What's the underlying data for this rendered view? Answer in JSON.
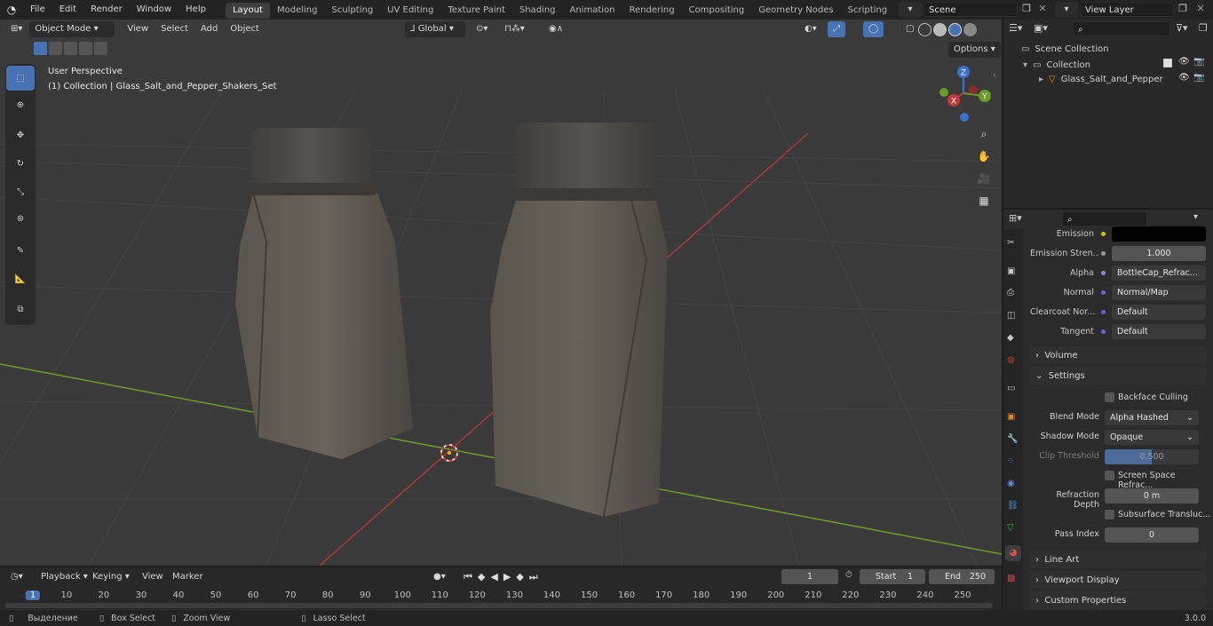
{
  "topbar": {
    "menus": [
      "File",
      "Edit",
      "Render",
      "Window",
      "Help"
    ],
    "workspaces": [
      "Layout",
      "Modeling",
      "Sculpting",
      "UV Editing",
      "Texture Paint",
      "Shading",
      "Animation",
      "Rendering",
      "Compositing",
      "Geometry Nodes",
      "Scripting"
    ],
    "active_workspace": "Layout",
    "scene": "Scene",
    "view_layer": "View Layer"
  },
  "viewport": {
    "mode": "Object Mode",
    "menus": [
      "View",
      "Select",
      "Add",
      "Object"
    ],
    "transform_orientation": "Global",
    "options_label": "Options",
    "perspective_label": "User Perspective",
    "collection_label": "(1) Collection | Glass_Salt_and_Pepper_Shakers_Set",
    "gizmo": {
      "z": "Z",
      "y": "Y",
      "x": "X"
    }
  },
  "outliner": {
    "root": "Scene Collection",
    "collection": "Collection",
    "object": "Glass_Salt_and_Pepper_S"
  },
  "properties": {
    "rows": [
      {
        "label": "Emission",
        "value": "",
        "socket": "#c8c800"
      },
      {
        "label": "Emission Stren...",
        "value": "1.000",
        "socket": ""
      },
      {
        "label": "Alpha",
        "value": "BottleCap_Refrac...",
        "socket": "#8c8cd8"
      },
      {
        "label": "Normal",
        "value": "Normal/Map",
        "socket": "#6464d8"
      },
      {
        "label": "Clearcoat Nor...",
        "value": "Default",
        "socket": "#6464d8"
      },
      {
        "label": "Tangent",
        "value": "Default",
        "socket": "#6464d8"
      }
    ],
    "volume": "Volume",
    "settings": "Settings",
    "backface": "Backface Culling",
    "blend_mode_label": "Blend Mode",
    "blend_mode": "Alpha Hashed",
    "shadow_mode_label": "Shadow Mode",
    "shadow_mode": "Opaque",
    "clip_label": "Clip Threshold",
    "clip_value": "0.500",
    "ssr": "Screen Space Refrac...",
    "refraction_label": "Refraction Depth",
    "refraction_value": "0 m",
    "sss": "Subsurface Transluc...",
    "pass_label": "Pass Index",
    "pass_value": "0",
    "line_art": "Line Art",
    "viewport_display": "Viewport Display",
    "custom_props": "Custom Properties"
  },
  "timeline": {
    "menus": [
      "Playback",
      "Keying",
      "View",
      "Marker"
    ],
    "current_frame": "1",
    "start_label": "Start",
    "start": "1",
    "end_label": "End",
    "end": "250",
    "ticks": [
      "1",
      "10",
      "20",
      "30",
      "40",
      "50",
      "60",
      "70",
      "80",
      "90",
      "100",
      "110",
      "120",
      "130",
      "140",
      "150",
      "160",
      "170",
      "180",
      "190",
      "200",
      "210",
      "220",
      "230",
      "240",
      "250"
    ]
  },
  "status": {
    "select": "Выделение",
    "box_select": "Box Select",
    "zoom_view": "Zoom View",
    "lasso": "Lasso Select",
    "version": "3.0.0"
  },
  "colors": {
    "accent": "#4772b3",
    "x_axis": "#c03b3b",
    "y_axis": "#6d9b2a",
    "z_axis": "#3b6fd1"
  }
}
